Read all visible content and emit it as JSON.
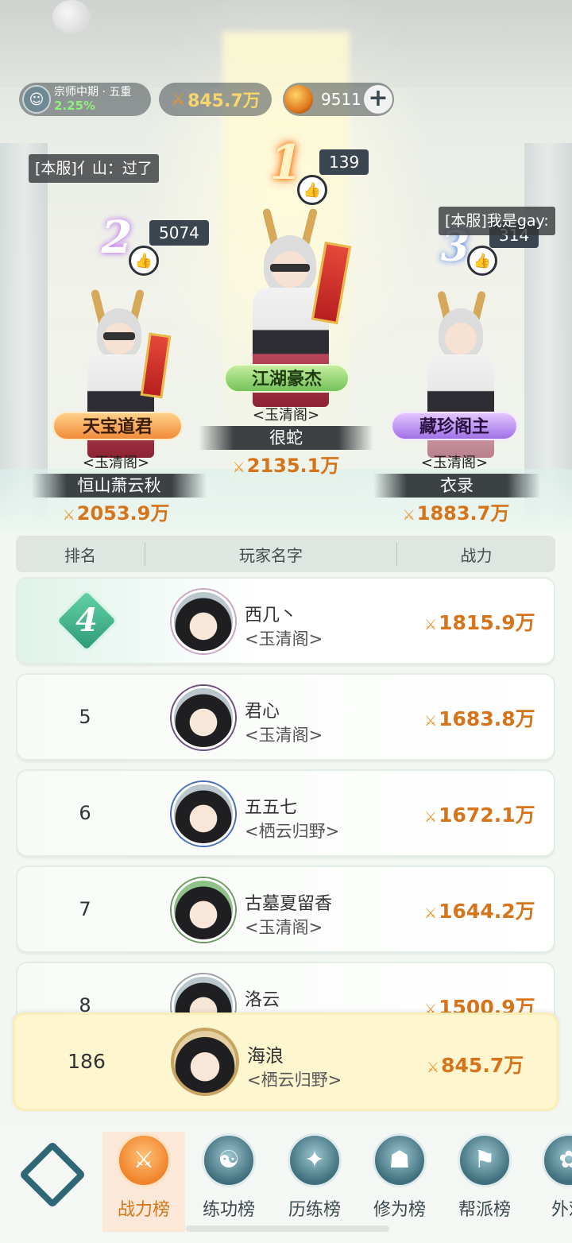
{
  "status": {
    "rank_title": "宗师中期 · 五重",
    "rank_pct": "2.25%",
    "power": "845.7万",
    "coins": "9511",
    "plus": "+"
  },
  "chats": {
    "left": "[本服]亻山：过了",
    "right": "[本服]我是gay:"
  },
  "podium": {
    "first": {
      "rank": "1",
      "likes": "139",
      "title": "江湖豪杰",
      "guild": "<玉清阁>",
      "name": "很蛇",
      "power": "2135.1万"
    },
    "second": {
      "rank": "2",
      "likes": "5074",
      "title": "天宝道君",
      "guild": "<玉清阁>",
      "name": "恒山萧云秋",
      "power": "2053.9万"
    },
    "third": {
      "rank": "3",
      "likes": "314",
      "title": "藏珍阁主",
      "guild": "<玉清阁>",
      "name": "衣录",
      "power": "1883.7万"
    }
  },
  "table": {
    "headers": {
      "rank": "排名",
      "name": "玩家名字",
      "power": "战力"
    },
    "rows": [
      {
        "rank": "4",
        "name": "西几丶",
        "guild": "<玉清阁>",
        "power": "1815.9万"
      },
      {
        "rank": "5",
        "name": "君心",
        "guild": "<玉清阁>",
        "power": "1683.8万"
      },
      {
        "rank": "6",
        "name": "五五七",
        "guild": "<栖云归野>",
        "power": "1672.1万"
      },
      {
        "rank": "7",
        "name": "古墓夏留香",
        "guild": "<玉清阁>",
        "power": "1644.2万"
      },
      {
        "rank": "8",
        "name": "洛云",
        "guild": "",
        "power": "1500.9万"
      }
    ],
    "me": {
      "rank": "186",
      "name": "海浪",
      "guild": "<栖云归野>",
      "power": "845.7万"
    }
  },
  "nav": {
    "items": [
      {
        "label": "战力榜",
        "icon": "crossed-swords-icon"
      },
      {
        "label": "练功榜",
        "icon": "yin-yang-icon"
      },
      {
        "label": "历练榜",
        "icon": "star-icon"
      },
      {
        "label": "修为榜",
        "icon": "hat-icon"
      },
      {
        "label": "帮派榜",
        "icon": "banner-icon"
      },
      {
        "label": "外观",
        "icon": "outfit-icon"
      }
    ]
  },
  "colors": {
    "accent": "#d6741a",
    "me_row": "#fdf6cf",
    "nav_active": "#fbe8d8"
  }
}
